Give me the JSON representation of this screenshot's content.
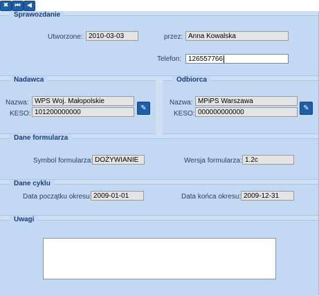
{
  "toolbar": {
    "close_icon": "✖",
    "first_icon": "⏮",
    "prev_icon": "◀"
  },
  "sprawozdanie": {
    "title": "Sprawozdanie",
    "created_label": "Utworzone:",
    "created_value": "2010-03-03",
    "by_label": "przez:",
    "by_value": "Anna Kowalska",
    "phone_label": "Telefon:",
    "phone_value": "126557766"
  },
  "nadawca": {
    "title": "Nadawca",
    "name_label": "Nazwa:",
    "name_value": "WPS Woj. Małopolskie",
    "keso_label": "KESO:",
    "keso_value": "101200000000",
    "edit_icon": "✎"
  },
  "odbiorca": {
    "title": "Odbiorca",
    "name_label": "Nazwa:",
    "name_value": "MPiPS Warszawa",
    "keso_label": "KESO:",
    "keso_value": "000000000000",
    "edit_icon": "✎"
  },
  "formularz": {
    "title": "Dane formularza",
    "symbol_label": "Symbol formularza:",
    "symbol_value": "DOŻYWIANIE",
    "version_label": "Wersja formularza:",
    "version_value": "1.2c"
  },
  "cykl": {
    "title": "Dane cyklu",
    "start_label": "Data początku okresu:",
    "start_value": "2009-01-01",
    "end_label": "Data końca okresu:",
    "end_value": "2009-12-31"
  },
  "uwagi": {
    "title": "Uwagi",
    "value": ""
  }
}
